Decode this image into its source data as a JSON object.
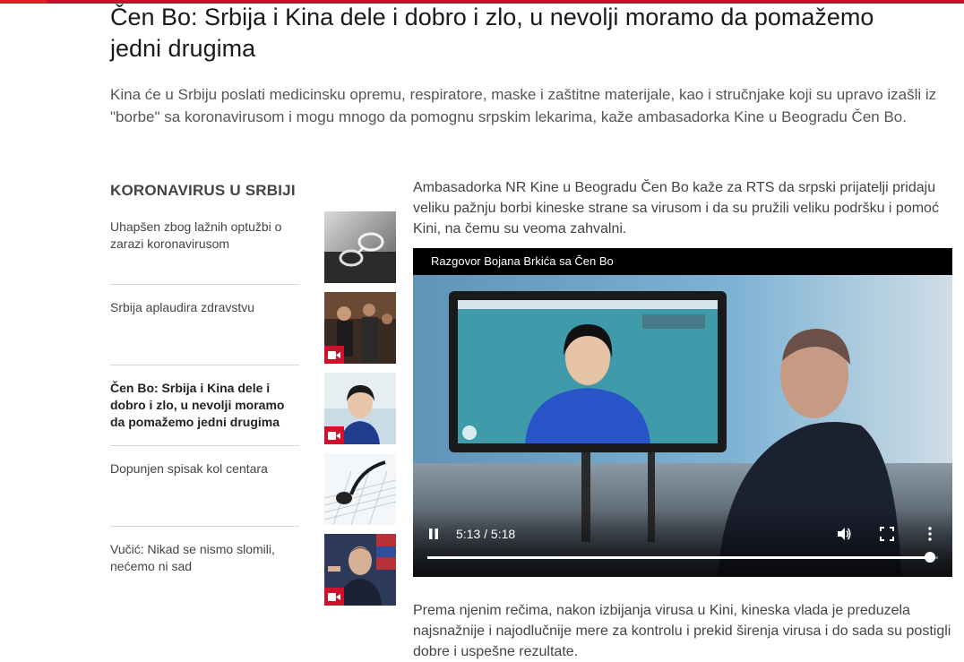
{
  "article": {
    "headline": "Čen Bo: Srbija i Kina dele i dobro i zlo, u nevolji moramo da pomažemo jedni drugima",
    "lead": "Kina će u Srbiju poslati medicinsku opremu, respiratore, maske i zaštitne materijale, kao i stručnjake koji su upravo izašli iz \"borbe\" sa koronavirusom i mogu mnogo da pomognu srpskim lekarima, kaže ambasadorka Kine u Beogradu Čen Bo.",
    "paragraph1": "Ambasadorka NR Kine u Beogradu Čen Bo kaže za RTS da srpski prijatelji pridaju veliku pažnju borbi kineske strane sa virusom i da su pružili veliku podršku i pomoć Kini, na čemu su veoma zahvalni.",
    "paragraph2": "Prema njenim rečima, nakon izbijanja virusa u Kini, kineska vlada je preduzela najsnažnije i najodlučnije mere za kontrolu i prekid širenja virusa i do sada su postigli dobre i uspešne rezultate."
  },
  "sidebar": {
    "title": "KORONAVIRUS U SRBIJI",
    "items": [
      {
        "label": "Uhapšen zbog lažnih optužbi o zarazi koronavirusom",
        "video": false,
        "thumb_icon": "handcuffs-photo"
      },
      {
        "label": "Srbija aplaudira zdravstvu",
        "video": true,
        "thumb_icon": "crowd-photo"
      },
      {
        "label": "Čen Bo: Srbija i Kina dele i dobro i zlo, u nevolji moramo da pomažemo jedni drugima",
        "video": true,
        "active": true,
        "thumb_icon": "portrait-photo"
      },
      {
        "label": "Dopunjen spisak kol centara",
        "video": false,
        "thumb_icon": "headset-keyboard-photo"
      },
      {
        "label": "Vučić: Nikad se nismo slomili, nećemo ni sad",
        "video": true,
        "thumb_icon": "press-conference-photo"
      }
    ]
  },
  "video": {
    "title": "Razgovor Bojana Brkića sa Čen Bo",
    "time_display": "5:13 / 5:18",
    "progress_fraction": 0.985,
    "state": "playing",
    "icons": [
      "pause-icon",
      "volume-icon",
      "fullscreen-icon",
      "more-options-icon"
    ]
  },
  "colors": {
    "brand_red": "#e31b23",
    "video_badge": "#d0112b"
  }
}
